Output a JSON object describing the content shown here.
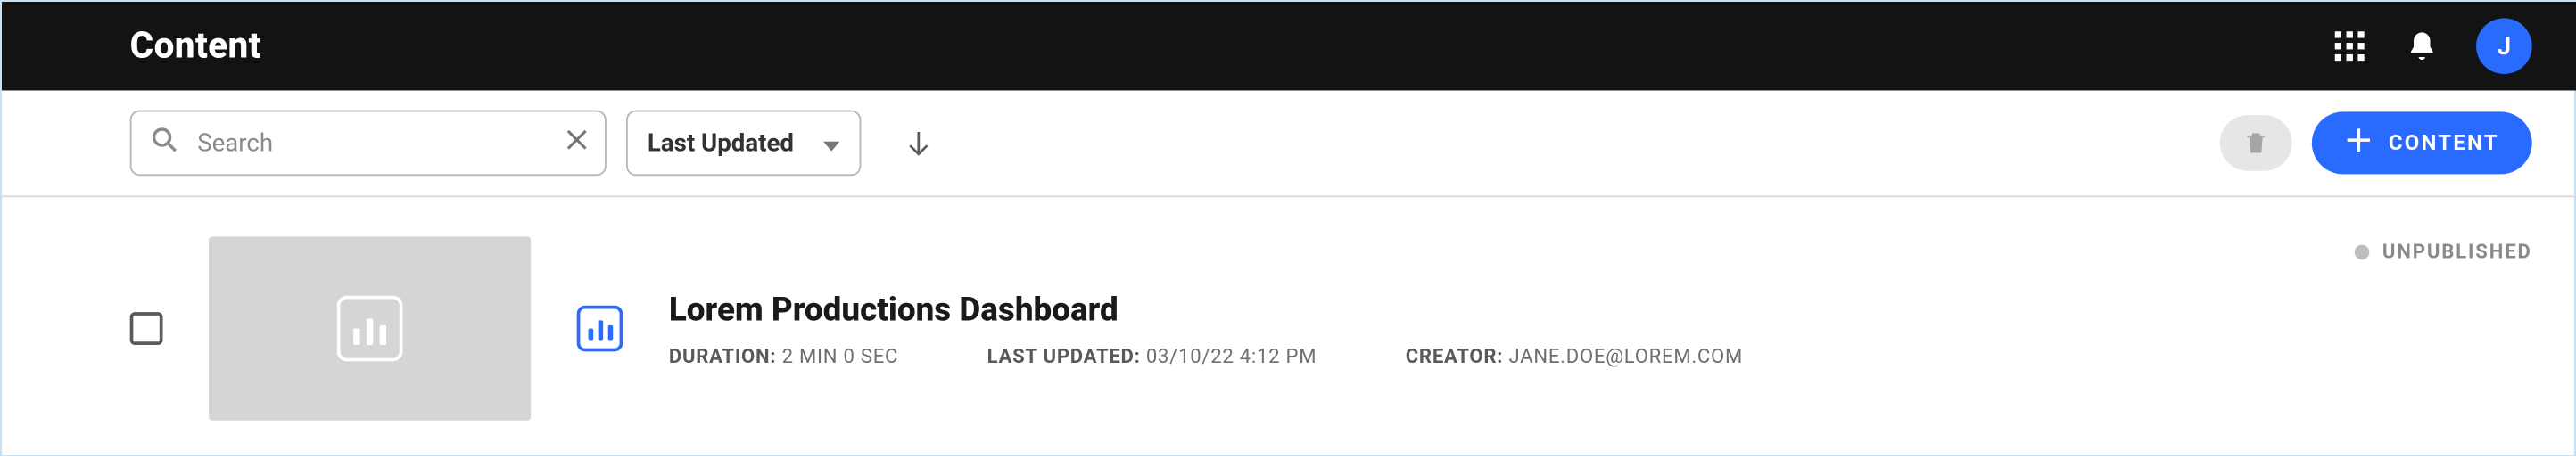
{
  "header": {
    "title": "Content",
    "avatar_initial": "J"
  },
  "toolbar": {
    "search_placeholder": "Search",
    "sort_label": "Last Updated",
    "create_button_label": "CONTENT"
  },
  "items": [
    {
      "title": "Lorem Productions Dashboard",
      "duration_label": "DURATION:",
      "duration_value": "2 MIN 0 SEC",
      "updated_label": "LAST UPDATED:",
      "updated_value": "03/10/22 4:12 PM",
      "creator_label": "CREATOR:",
      "creator_value": "JANE.DOE@LOREM.COM",
      "status": "UNPUBLISHED"
    }
  ]
}
